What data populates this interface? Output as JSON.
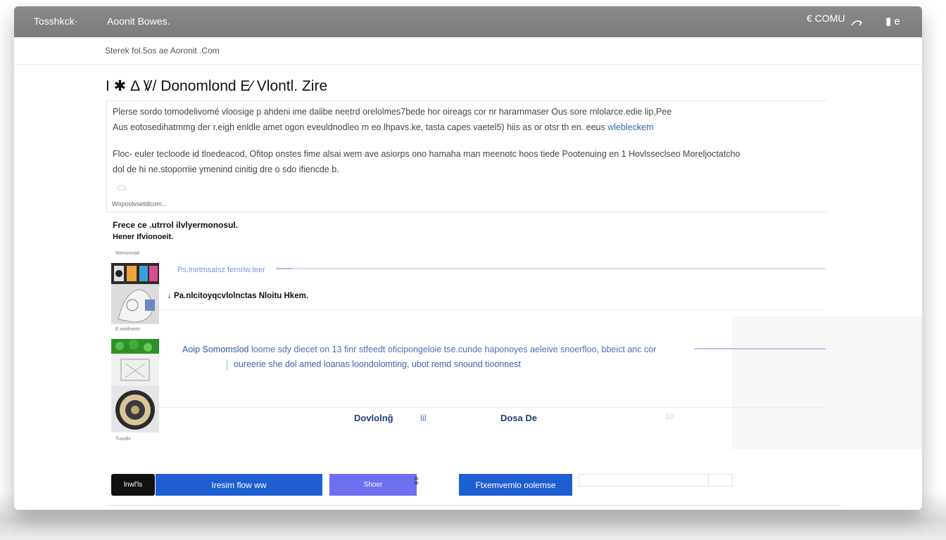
{
  "topbar": {
    "brand": "Tosshkck·",
    "nav_label": "Aoonit Bowes.",
    "account_label": "€ COMU",
    "menu_label": "▮ e"
  },
  "breadcrumb": "Sterek fol.5os ae Aoronit .Com",
  "page_title": "I ✱ Δ Ꝟ/  Donomlond E⁄ Vlontl. Zire",
  "intro": {
    "para1_line1": "Plerse sordo tomodelivomé vloosige p ahdeni ime dalibe neetrd orelolmes7bede hor oireags cor nr hararnmaser Ous sore rnlolarce.edie lip,Pee",
    "para1_line2": "Aus eotosedihatmmg der r.eigh enldle amet ogon eveuldnodleo m eo lhpavs.ke, tasta capes vaetel5) hiis as or otsr th en. eeus",
    "para1_link": "wlebleckem",
    "para2_line1": "Floc- euler tecloode id tlnedeacod, Ofitop onstes fime alsai wem ave asiorps ono hamaha man meenotc hoos tiede Pootenuing en 1 Hovlsseclseo Moreljoctatcho",
    "para2_line2": "dol de hi ne.stoporriie ymenind cinitig dre o sdo ifiencde b.",
    "caption": "Wopoolvsetdlcom..."
  },
  "section": {
    "heading1": "Frece ce .utrrol ilvlyermonosul.",
    "heading2": "Hener Ifvionoeit.",
    "tiny_label": "Wenonnad"
  },
  "progress": {
    "label": "Ps.lnetmsaisz fernrlw.leer",
    "fraction": 0.03
  },
  "package": {
    "line": "↓ Pa.nlcitoyqcvlolnctas Nloitu Hkem.",
    "desc_main": "Aoip Somomslod",
    "desc_rest": "loome sdy diecet on 13 finr stfeedt oficipongeloie tse.cunde haponoyes aeleive snoerfloo, bbeict anc cor",
    "desc2": "oureerie she dol amed loanas loondolomting, ubot remd snound tioonnest"
  },
  "labels": {
    "download": "Dovlolnĝ",
    "mid": "lil",
    "dose": "Dosa De",
    "faint": "10"
  },
  "thumbnail_captions": {
    "cap1": "E.wodneon",
    "cap2": "Tusoilv"
  },
  "buttons": {
    "dark": "lnwl'ls",
    "primary": "Iresim flow ww",
    "secondary": "Shoer",
    "glyph": "⁑",
    "tertiary": "Ftxemvemlo oolemse"
  },
  "colors": {
    "topbar": "#808080",
    "primary": "#1d5fd3",
    "secondary": "#6f6ff1",
    "link": "#3a5fb0"
  }
}
